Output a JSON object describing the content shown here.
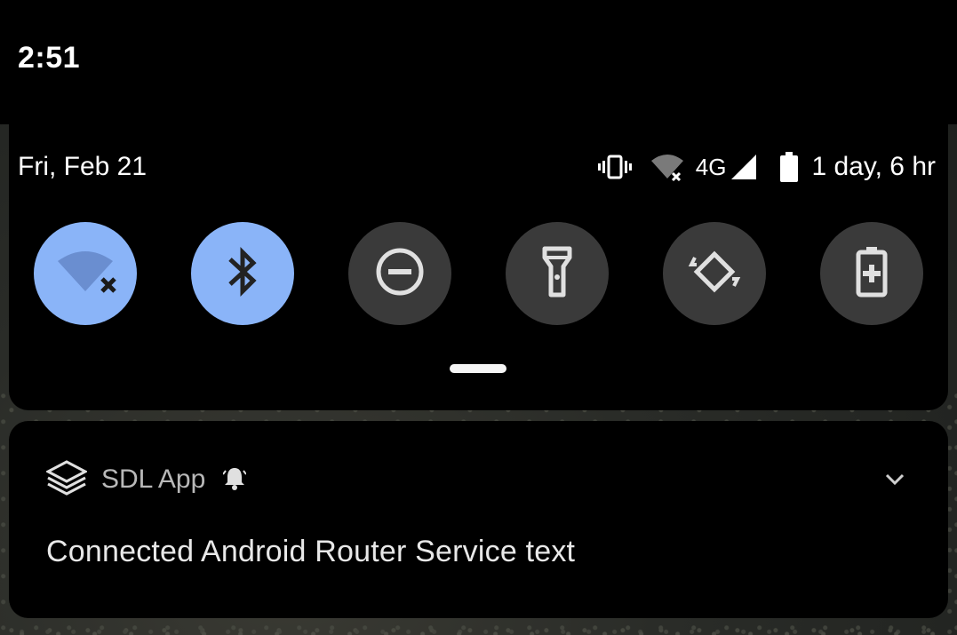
{
  "status_bar": {
    "time": "2:51"
  },
  "quick_settings": {
    "date": "Fri, Feb 21",
    "network_type": "4G",
    "battery_estimate": "1 day, 6 hr",
    "tiles": [
      {
        "name": "wifi",
        "icon": "wifi-off-icon",
        "active": true
      },
      {
        "name": "bluetooth",
        "icon": "bluetooth-icon",
        "active": true
      },
      {
        "name": "do-not-disturb",
        "icon": "do-not-disturb-icon",
        "active": false
      },
      {
        "name": "flashlight",
        "icon": "flashlight-icon",
        "active": false
      },
      {
        "name": "auto-rotate",
        "icon": "auto-rotate-icon",
        "active": false
      },
      {
        "name": "battery-saver",
        "icon": "battery-saver-icon",
        "active": false
      }
    ]
  },
  "notification": {
    "app_name": "SDL App",
    "text": "Connected Android Router Service text"
  },
  "colors": {
    "active_tile": "#8ab4f8",
    "inactive_tile": "#3a3a3a",
    "panel": "#000000"
  }
}
